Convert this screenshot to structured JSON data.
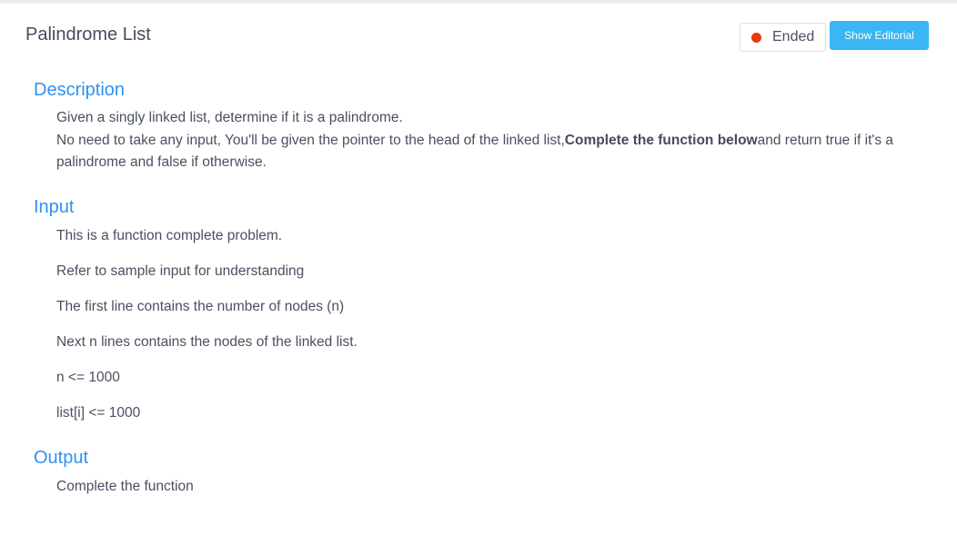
{
  "problem": {
    "title": "Palindrome List",
    "status": "Ended",
    "show_editorial_label": "Show Editorial",
    "status_color": "#e8390e",
    "accent_color": "#39b6f3",
    "heading_color": "#3091f2"
  },
  "description": {
    "heading": "Description",
    "line1": "Given a singly linked list, determine if it is a palindrome.",
    "line2_before": "No need to take any input, You'll be given the pointer to the head of the linked list,",
    "line2_bold": "Complete the function below",
    "line2_after": "and return true if it's a palindrome and false if otherwise."
  },
  "input": {
    "heading": "Input",
    "lines": [
      "This is a function complete problem.",
      "Refer to sample input for understanding",
      "The first line contains the number of nodes (n)",
      "Next n lines contains the nodes of the linked list.",
      "n <= 1000",
      "list[i] <= 1000"
    ]
  },
  "output": {
    "heading": "Output",
    "text": "Complete the function"
  }
}
